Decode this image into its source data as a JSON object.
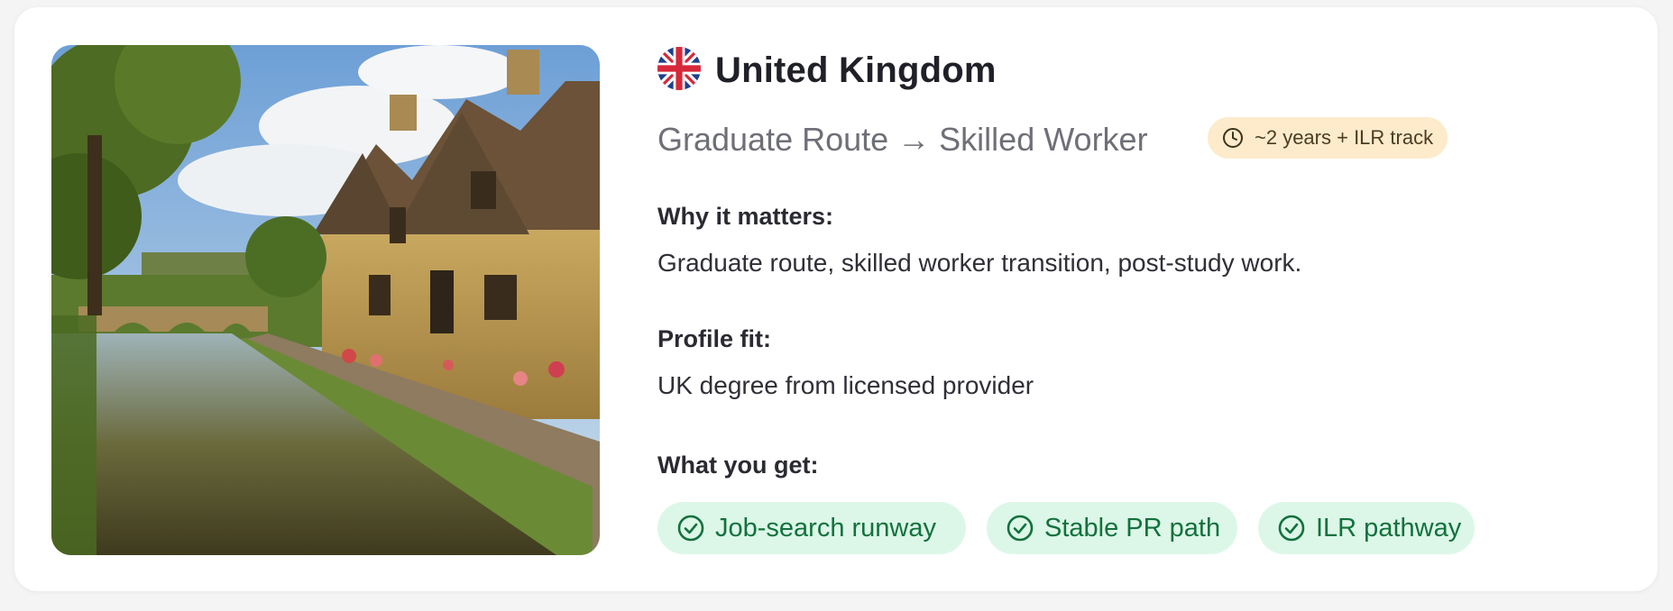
{
  "country": {
    "name": "United Kingdom",
    "flag": "uk-flag-icon"
  },
  "route": {
    "title": "Graduate Route → Skilled Worker",
    "badge": "~2 years + ILR track",
    "badge_icon": "clock-icon"
  },
  "sections": {
    "why": {
      "label": "Why it matters:",
      "text": "Graduate route, skilled worker transition, post-study work."
    },
    "fit": {
      "label": "Profile fit:",
      "text": "UK degree from licensed provider"
    },
    "get": {
      "label": "What you get:"
    }
  },
  "benefits": [
    {
      "label": "Job-search runway",
      "icon": "check-circle-icon"
    },
    {
      "label": "Stable PR path",
      "icon": "check-circle-icon"
    },
    {
      "label": "ILR pathway",
      "icon": "check-circle-icon"
    }
  ],
  "colors": {
    "badge_bg": "#fdebcc",
    "chip_bg": "#dcf7e8",
    "chip_text": "#12713d"
  }
}
